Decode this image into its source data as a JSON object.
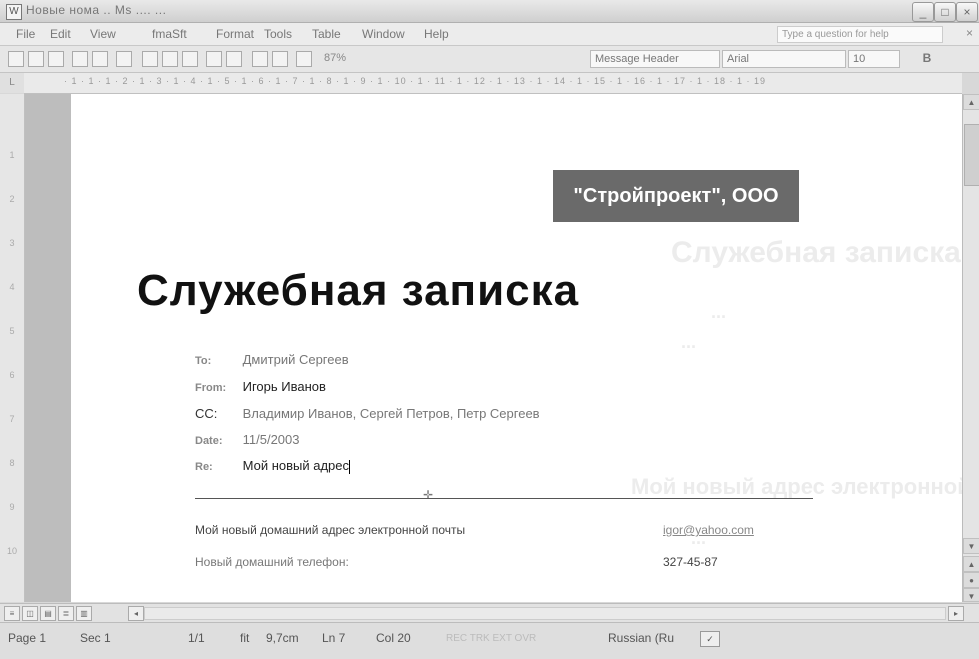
{
  "window": {
    "title": "Новыe нома  ..  Мs ....  ...",
    "app_icon": "W"
  },
  "menu": {
    "items": [
      "File",
      "Edit",
      "View",
      "fmaSft",
      "Format",
      "Tools",
      "Table",
      "Window",
      "Help"
    ],
    "help_placeholder": "Type a question for help",
    "close_label": "×"
  },
  "toolbar": {
    "zoom": "87%",
    "style": "Message Header",
    "font": "Arial",
    "size": "10",
    "bold": "B"
  },
  "ruler": {
    "corner": "L",
    "scale": "· 1 · 1 · 1 · 2 · 1 · 3 · 1 · 4 · 1 · 5 · 1 · 6 · 1 · 7 · 1 · 8 · 1 · 9 · 1 · 10 · 1 · 11 · 1 · 12 · 1 · 13 · 1 · 14 · 1 · 15 · 1 · 16 · 1 · 17 · 1 · 18 · 1 · 19",
    "vertical": [
      "1",
      "2",
      "3",
      "4",
      "5",
      "6",
      "7",
      "8",
      "9",
      "10"
    ]
  },
  "document": {
    "company": "\"Стройпроект\", ООО",
    "heading": "Служебная записка",
    "ghost_lines": [
      "Служебная записка",
      "...",
      "...",
      "Мой новый адрес электронной почты",
      "..."
    ],
    "header_fields": [
      {
        "label": "To:",
        "value": "Дмитрий Сергеев"
      },
      {
        "label": "From:",
        "value": "Игорь Иванов"
      },
      {
        "label": "CC:",
        "value": "Владимир Иванов, Сергей Петров, Петр Сергеев"
      },
      {
        "label": "Date:",
        "value": "11/5/2003"
      },
      {
        "label": "Re:",
        "value": "Мой новый адрес"
      }
    ],
    "info": [
      {
        "label": "Мой новый домашний адрес электронной почты",
        "value": "igor@yahoo.com"
      },
      {
        "label": "Новый домашний телефон:",
        "value": "327-45-87"
      }
    ]
  },
  "status": {
    "page": "Page 1",
    "sec": "Sec 1",
    "pages": "1/1",
    "at_mode": "fit",
    "at": "9,7cm",
    "ln": "Ln 7",
    "col": "Col 20",
    "modes": "REC TRK EXT OVR",
    "language": "Russian (Ru",
    "spell_icon": "spellcheck-book-icon"
  }
}
